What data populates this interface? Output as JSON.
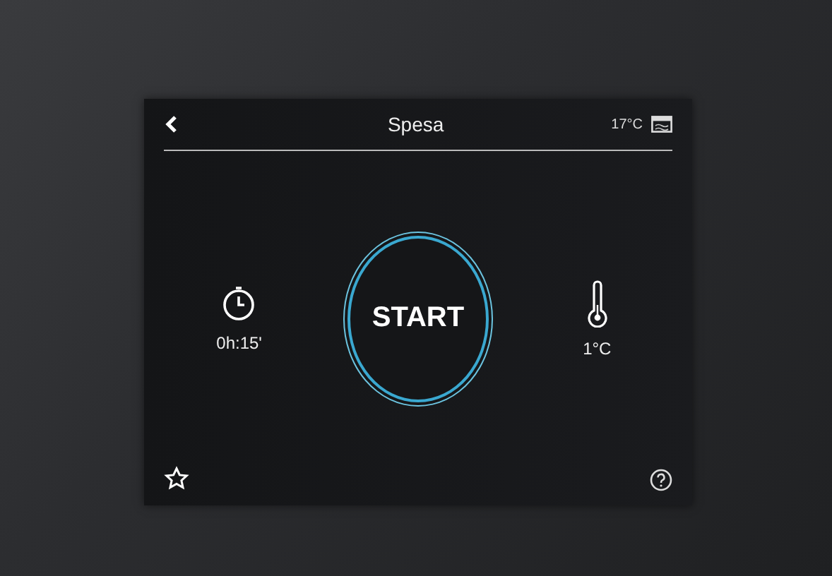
{
  "header": {
    "title": "Spesa",
    "chamber_temperature": "17°C"
  },
  "timer": {
    "value": "0h:15'"
  },
  "start_button": {
    "label": "START"
  },
  "probe": {
    "value": "1°C"
  }
}
